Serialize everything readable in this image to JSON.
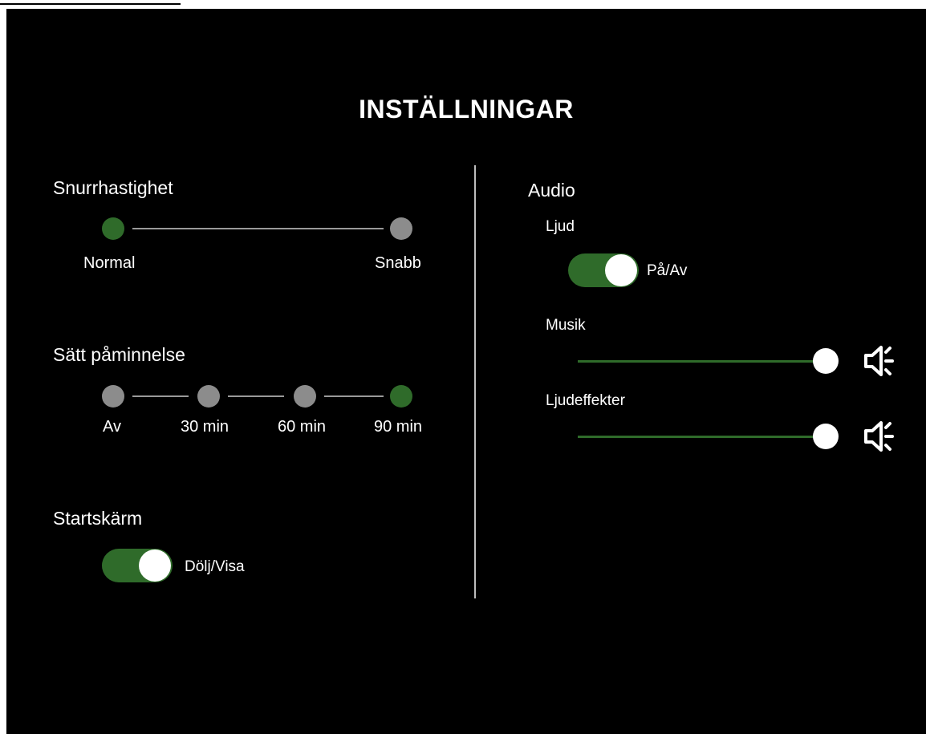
{
  "title": "INSTÄLLNINGAR",
  "colors": {
    "accent_green": "#2f6b2a",
    "inactive_dot": "#8c8c8c",
    "background": "#000000"
  },
  "spin_speed": {
    "label": "Snurrhastighet",
    "options": [
      "Normal",
      "Snabb"
    ],
    "selected": "Normal"
  },
  "reminder": {
    "label": "Sätt påminnelse",
    "options": [
      "Av",
      "30 min",
      "60 min",
      "90 min"
    ],
    "selected": "90 min"
  },
  "start_screen": {
    "label": "Startskärm",
    "toggle_label": "Dölj/Visa",
    "on": true
  },
  "audio": {
    "label": "Audio",
    "sound": {
      "label": "Ljud",
      "toggle_label": "På/Av",
      "on": true
    },
    "music": {
      "label": "Musik",
      "level": 1.0,
      "icon": "speaker-icon"
    },
    "effects": {
      "label": "Ljudeffekter",
      "level": 1.0,
      "icon": "speaker-icon"
    }
  }
}
